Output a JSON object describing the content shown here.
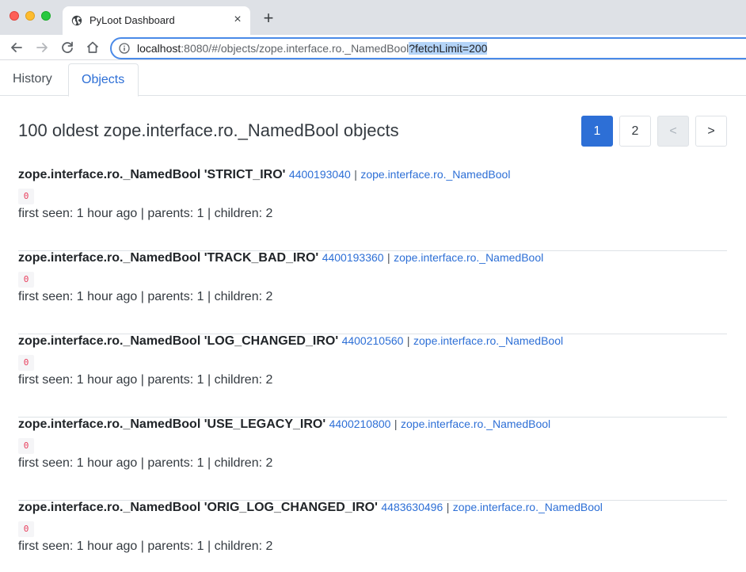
{
  "browser": {
    "tab_title": "PyLoot Dashboard",
    "tab_close": "×",
    "new_tab": "+",
    "url_host": "localhost",
    "url_rest": ":8080/#/objects/zope.interface.ro._NamedBool",
    "url_selected": "?fetchLimit=200"
  },
  "nav": {
    "tabs": [
      {
        "label": "History"
      },
      {
        "label": "Objects",
        "active": true
      }
    ]
  },
  "main": {
    "heading": "100 oldest zope.interface.ro._NamedBool objects",
    "pagination": {
      "pages": [
        "1",
        "2"
      ],
      "prev": "<",
      "next": ">",
      "active": "1"
    },
    "items": [
      {
        "name": "zope.interface.ro._NamedBool 'STRICT_IRO'",
        "id": "4400193040",
        "sep": "|",
        "type": "zope.interface.ro._NamedBool",
        "badge": "0",
        "meta": "first seen: 1 hour ago | parents: 1 | children: 2"
      },
      {
        "name": "zope.interface.ro._NamedBool 'TRACK_BAD_IRO'",
        "id": "4400193360",
        "sep": "|",
        "type": "zope.interface.ro._NamedBool",
        "badge": "0",
        "meta": "first seen: 1 hour ago | parents: 1 | children: 2"
      },
      {
        "name": "zope.interface.ro._NamedBool 'LOG_CHANGED_IRO'",
        "id": "4400210560",
        "sep": "|",
        "type": "zope.interface.ro._NamedBool",
        "badge": "0",
        "meta": "first seen: 1 hour ago | parents: 1 | children: 2"
      },
      {
        "name": "zope.interface.ro._NamedBool 'USE_LEGACY_IRO'",
        "id": "4400210800",
        "sep": "|",
        "type": "zope.interface.ro._NamedBool",
        "badge": "0",
        "meta": "first seen: 1 hour ago | parents: 1 | children: 2"
      },
      {
        "name": "zope.interface.ro._NamedBool 'ORIG_LOG_CHANGED_IRO'",
        "id": "4483630496",
        "sep": "|",
        "type": "zope.interface.ro._NamedBool",
        "badge": "0",
        "meta": "first seen: 1 hour ago | parents: 1 | children: 2"
      }
    ]
  },
  "colors": {
    "accent": "#2d6fd6",
    "badge_text": "#e83e5c",
    "chrome": "#dee1e6"
  }
}
